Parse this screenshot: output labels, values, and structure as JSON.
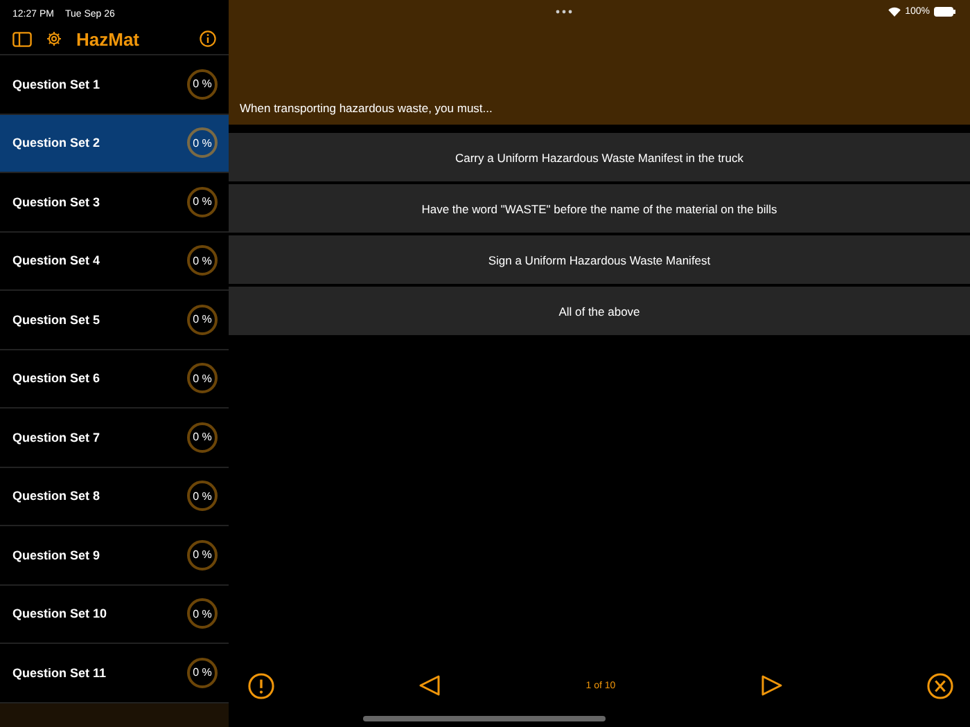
{
  "status_bar": {
    "time": "12:27 PM",
    "date": "Tue Sep 26",
    "battery": "100%"
  },
  "sidebar": {
    "title": "HazMat",
    "items": [
      {
        "label": "Question Set 1",
        "progress": "0 %",
        "selected": false
      },
      {
        "label": "Question Set 2",
        "progress": "0 %",
        "selected": true
      },
      {
        "label": "Question Set 3",
        "progress": "0 %",
        "selected": false
      },
      {
        "label": "Question Set 4",
        "progress": "0 %",
        "selected": false
      },
      {
        "label": "Question Set 5",
        "progress": "0 %",
        "selected": false
      },
      {
        "label": "Question Set 6",
        "progress": "0 %",
        "selected": false
      },
      {
        "label": "Question Set 7",
        "progress": "0 %",
        "selected": false
      },
      {
        "label": "Question Set 8",
        "progress": "0 %",
        "selected": false
      },
      {
        "label": "Question Set 9",
        "progress": "0 %",
        "selected": false
      },
      {
        "label": "Question Set 10",
        "progress": "0 %",
        "selected": false
      },
      {
        "label": "Question Set 11",
        "progress": "0 %",
        "selected": false
      }
    ]
  },
  "question": "When transporting hazardous waste, you must...",
  "answers": [
    "Carry a Uniform Hazardous Waste Manifest in the truck",
    "Have the word \"WASTE\" before the name of the material on the bills",
    "Sign a Uniform Hazardous Waste Manifest",
    "All of the above"
  ],
  "toolbar": {
    "counter": "1 of 10"
  }
}
